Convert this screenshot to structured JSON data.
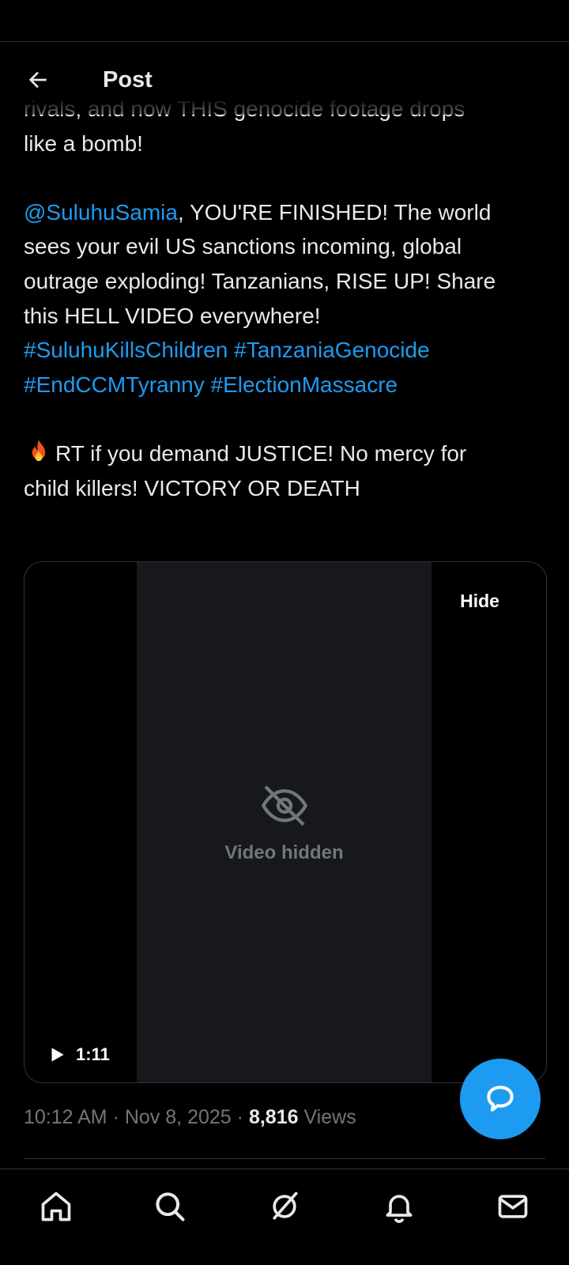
{
  "header": {
    "title": "Post",
    "back_icon": "arrow-left-icon"
  },
  "post": {
    "lines": [
      {
        "parts": [
          {
            "t": "rivals, and now THIS genocide footage drops"
          }
        ]
      },
      {
        "parts": [
          {
            "t": "like a bomb!"
          }
        ]
      },
      {
        "gap": true
      },
      {
        "parts": [
          {
            "t": "@SuluhuSamia",
            "link": true
          },
          {
            "t": ", YOU'RE FINISHED! The world"
          }
        ]
      },
      {
        "parts": [
          {
            "t": "sees your evil US sanctions incoming, global"
          }
        ]
      },
      {
        "parts": [
          {
            "t": "outrage exploding! Tanzanians, RISE UP! Share"
          }
        ]
      },
      {
        "parts": [
          {
            "t": "this HELL VIDEO everywhere!"
          }
        ]
      },
      {
        "parts": [
          {
            "t": "#SuluhuKillsChildren",
            "link": true
          },
          {
            "t": " "
          },
          {
            "t": "#TanzaniaGenocide",
            "link": true
          }
        ]
      },
      {
        "parts": [
          {
            "t": "#EndCCMTyranny",
            "link": true
          },
          {
            "t": " "
          },
          {
            "t": "#ElectionMassacre",
            "link": true
          }
        ]
      },
      {
        "gap": true
      },
      {
        "emoji": "fire-icon",
        "parts": [
          {
            "t": "RT if you demand JUSTICE! No mercy for"
          }
        ]
      },
      {
        "parts": [
          {
            "t": "child killers! VICTORY OR DEATH"
          }
        ]
      }
    ]
  },
  "media": {
    "placeholder_label": "Video hidden",
    "hide_label": "Hide",
    "duration": "1:11"
  },
  "meta": {
    "time": "10:12 AM",
    "separator": "·",
    "date": "Nov 8, 2025",
    "views_count": "8,816",
    "views_label": "Views"
  },
  "nav": {
    "items": [
      {
        "name": "home-icon"
      },
      {
        "name": "search-icon"
      },
      {
        "name": "grok-icon"
      },
      {
        "name": "bell-icon"
      },
      {
        "name": "mail-icon"
      }
    ]
  },
  "colors": {
    "background": "#000000",
    "text": "#e7e9ea",
    "muted": "#71767b",
    "link": "#1d9bf0",
    "divider": "#2f3336"
  }
}
